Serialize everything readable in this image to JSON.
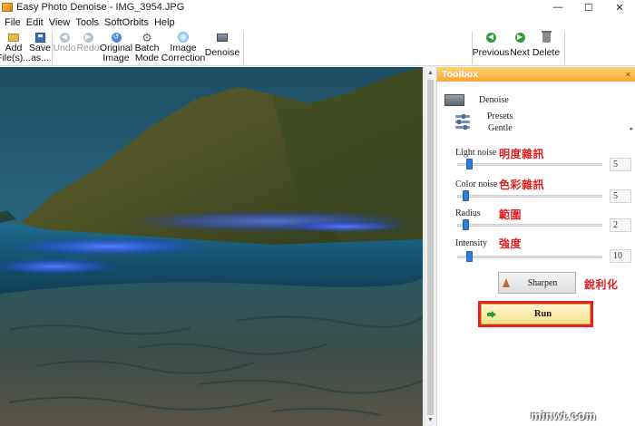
{
  "window": {
    "title": "Easy Photo Denoise - IMG_3954.JPG",
    "minimize_glyph": "—",
    "maximize_glyph": "☐",
    "close_glyph": "✕"
  },
  "menu": [
    "File",
    "Edit",
    "View",
    "Tools",
    "SoftOrbits",
    "Help"
  ],
  "toolbar": {
    "add_files": "Add\nFile(s)...",
    "save_as": "Save\nas...",
    "undo": "Undo",
    "redo": "Redo",
    "original_image": "Original\nImage",
    "batch_mode": "Batch\nMode",
    "image_correction": "Image\nCorrection",
    "denoise": "Denoise",
    "previous": "Previous",
    "next": "Next",
    "delete": "Delete"
  },
  "toolbox": {
    "title": "Toolbox",
    "close_glyph": "×",
    "denoise_label": "Denoise",
    "presets_label": "Presets",
    "preset_value": "Gentle",
    "sliders": [
      {
        "label": "Light noise",
        "annotation": "明度雜訊",
        "value": "5",
        "fraction": 0.06
      },
      {
        "label": "Color noise",
        "annotation": "色彩雜訊",
        "value": "5",
        "fraction": 0.04
      },
      {
        "label": "Radius",
        "annotation": "範圍",
        "value": "2",
        "fraction": 0.04
      },
      {
        "label": "Intensity",
        "annotation": "強度",
        "value": "10",
        "fraction": 0.06
      }
    ],
    "sharpen_label": "Sharpen",
    "sharpen_annotation": "銳利化",
    "run_label": "Run"
  },
  "watermark": "minwt.com",
  "colors": {
    "toolbox_header": "#f6a935",
    "slider_thumb": "#2f7fd8",
    "annotation": "#e02020",
    "run_highlight": "#e82020"
  }
}
